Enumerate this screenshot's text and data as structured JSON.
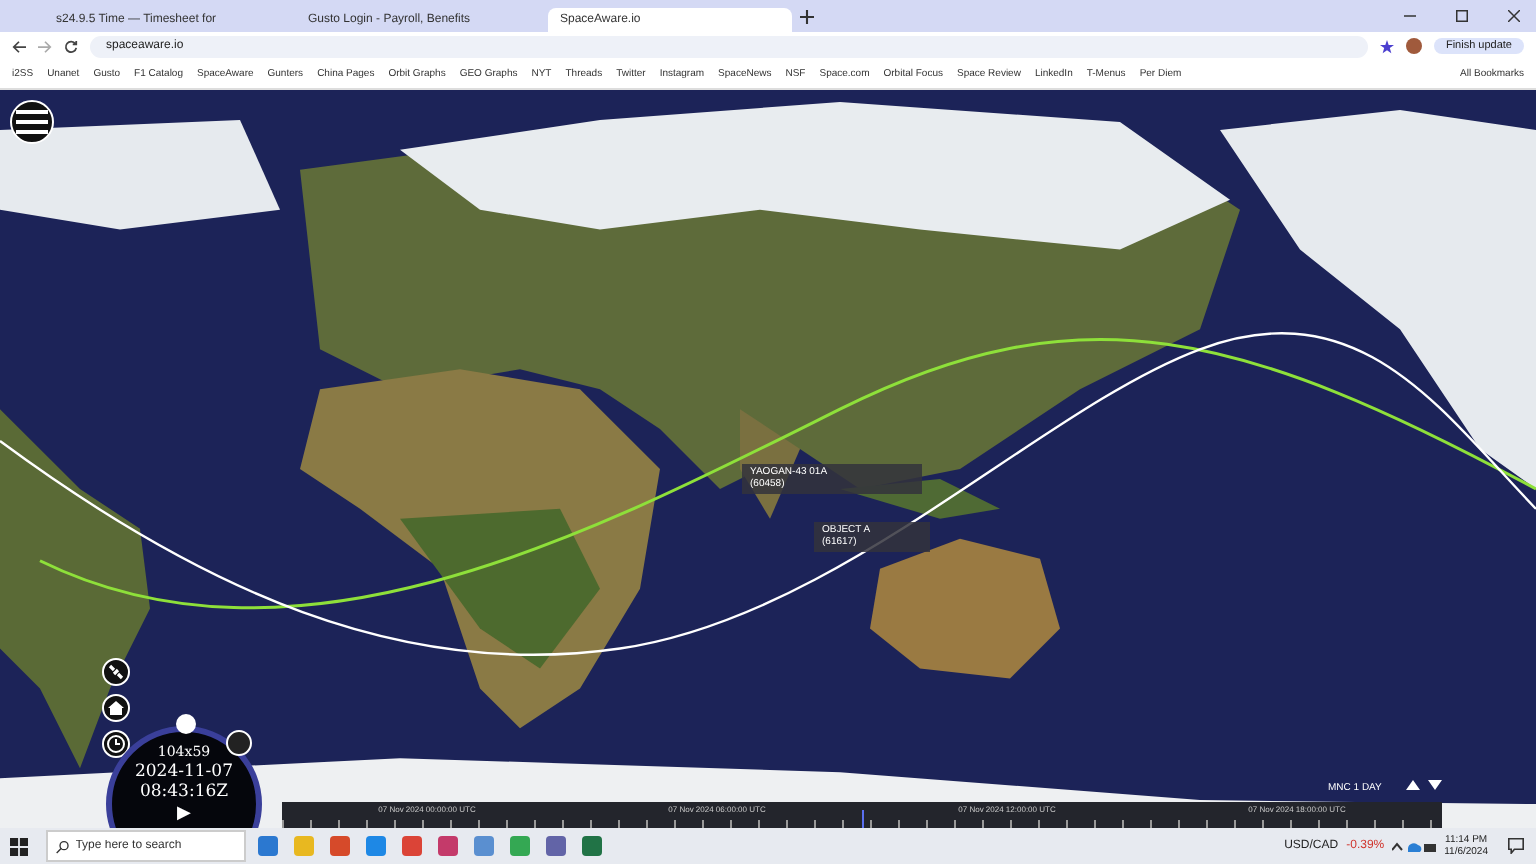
{
  "browser": {
    "tabs": [
      {
        "label": "s24.9.5 Time — Timesheet for",
        "selected": false
      },
      {
        "label": "Gusto Login - Payroll, Benefits",
        "selected": false
      },
      {
        "label": "SpaceAware.io",
        "selected": true
      }
    ],
    "url": "spaceaware.io",
    "update_button": "Finish update",
    "bookmarks": [
      "i2SS",
      "Unanet",
      "Gusto",
      "F1 Catalog",
      "SpaceAware",
      "Gunters",
      "China Pages",
      "Orbit Graphs",
      "GEO Graphs",
      "NYT",
      "Threads",
      "Twitter",
      "Instagram",
      "SpaceNews",
      "NSF",
      "Space.com",
      "Orbital Focus",
      "Space Review",
      "LinkedIn",
      "T-Menus",
      "Per Diem"
    ],
    "all_bookmarks": "All Bookmarks"
  },
  "map": {
    "satellites": [
      {
        "name": "YAOGAN-43 01A",
        "id": "(60458)"
      },
      {
        "name": "OBJECT A",
        "id": "(61617)"
      }
    ],
    "clock": {
      "resolution": "104x59",
      "date": "2024-11-07",
      "time": "08:43:16Z",
      "play": "▶"
    },
    "timeline": {
      "labels": [
        "07 Nov 2024 00:00:00 UTC",
        "07 Nov 2024 06:00:00 UTC",
        "07 Nov 2024 12:00:00 UTC",
        "07 Nov 2024 18:00:00 UTC"
      ],
      "speed": "MNC 1 DAY"
    }
  },
  "taskbar": {
    "search_placeholder": "Type here to search",
    "ticker": "USD/CAD",
    "change": "-0.39%",
    "time": "11:14 PM",
    "date": "11/6/2024"
  }
}
